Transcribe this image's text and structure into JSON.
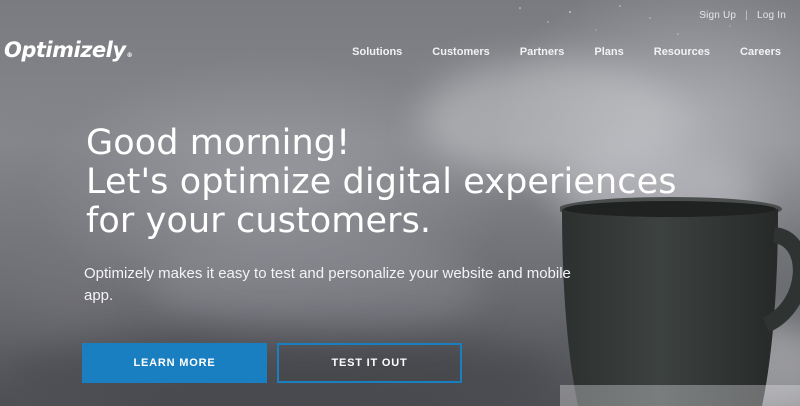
{
  "header": {
    "logo_text": "Optimizely",
    "top_links": {
      "signup": "Sign Up",
      "separator": "|",
      "login": "Log In"
    },
    "nav": [
      "Solutions",
      "Customers",
      "Partners",
      "Plans",
      "Resources",
      "Careers"
    ]
  },
  "hero": {
    "headline": [
      "Good morning!",
      "Let's optimize digital experiences",
      "for your customers."
    ],
    "subtext": "Optimizely makes it easy to test and personalize your website and mobile app.",
    "buttons": {
      "learn_more": "LEARN MORE",
      "test_it_out": "TEST IT OUT"
    }
  },
  "colors": {
    "accent": "#1a7fc0",
    "text": "#ffffff"
  },
  "icons": {
    "logo": "optimizely-logo",
    "mug": "coffee-mug-image"
  }
}
